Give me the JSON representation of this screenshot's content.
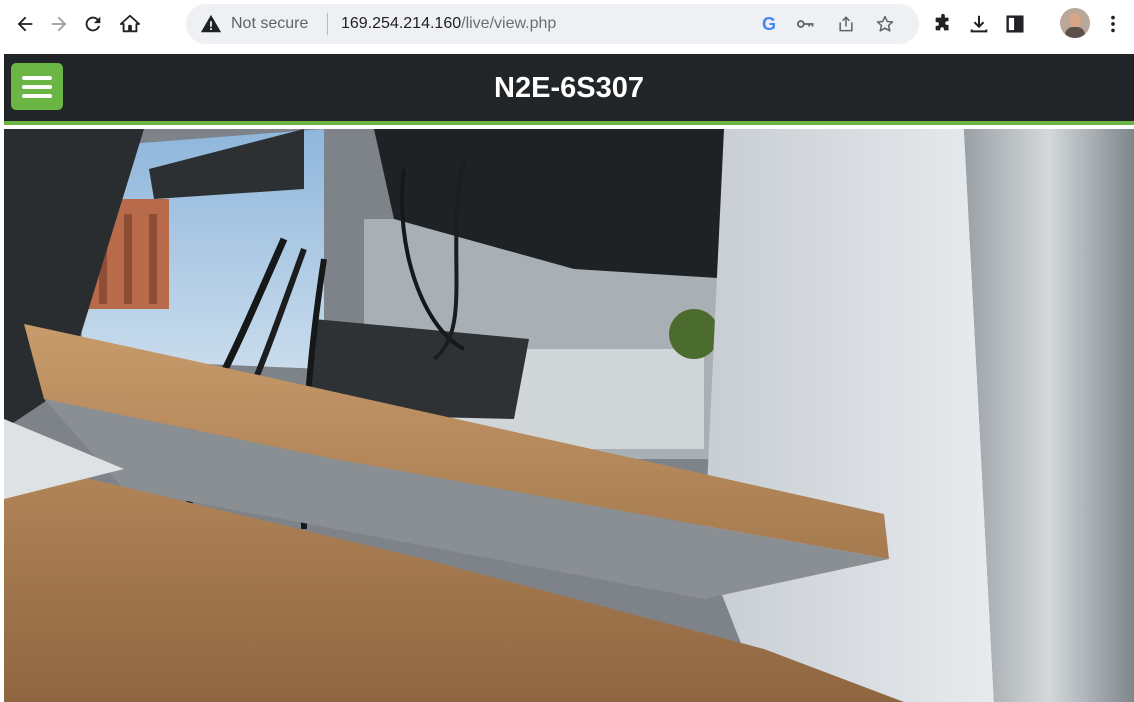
{
  "browser": {
    "security_label": "Not secure",
    "url_host": "169.254.214.160",
    "url_path": "/live/view.php",
    "icons": {
      "back": "back-arrow-icon",
      "forward": "forward-arrow-icon",
      "reload": "reload-icon",
      "home": "home-icon",
      "warning": "warning-icon",
      "google": "google-icon",
      "key": "key-icon",
      "share": "share-icon",
      "star": "star-icon",
      "extensions": "puzzle-icon",
      "download": "download-icon",
      "side_panel": "side-panel-icon",
      "profile": "avatar",
      "menu": "kebab-menu-icon"
    },
    "google_letter": "G"
  },
  "app": {
    "title": "N2E-6S307",
    "menu_icon": "hamburger-icon",
    "accent_color": "#6ab544",
    "header_color": "#222528"
  },
  "live_view": {
    "content": "camera-live-image"
  }
}
